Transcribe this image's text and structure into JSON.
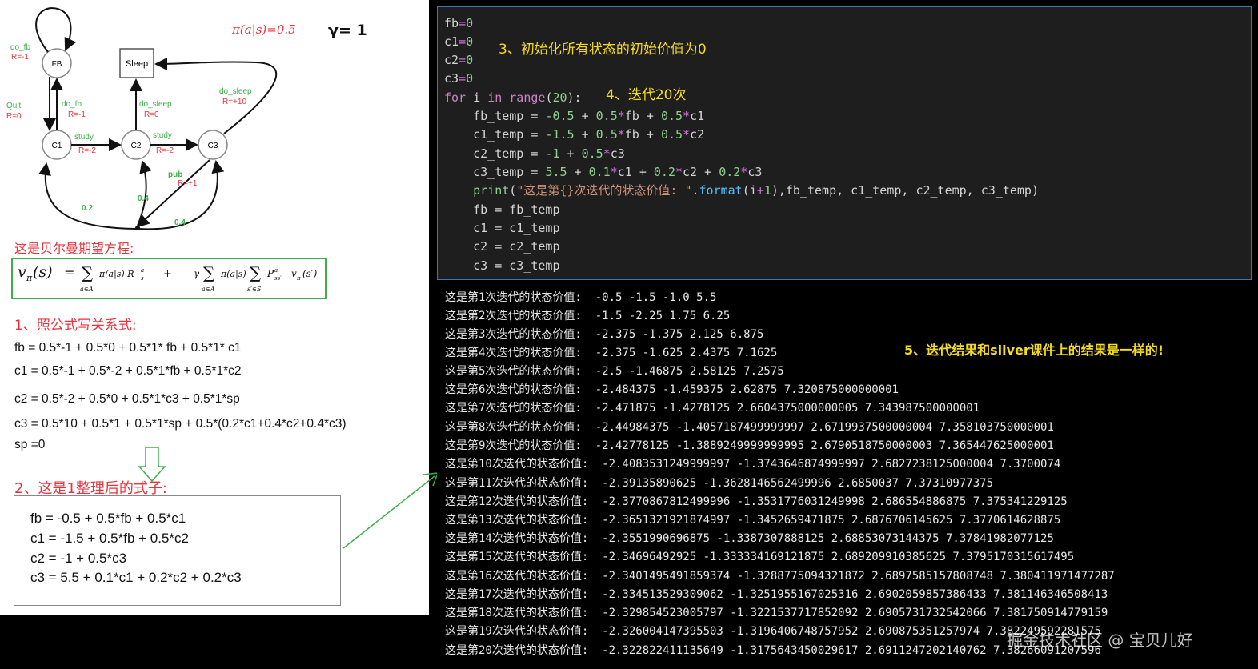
{
  "diagram": {
    "policy": "π(a|s)=0.5",
    "gamma": "γ= 1",
    "states": {
      "fb": "FB",
      "sleep": "Sleep",
      "c1": "C1",
      "c2": "C2",
      "c3": "C3"
    },
    "actions": {
      "do_fb_loop": "do_fb",
      "do_fb_loop_r": "R=-1",
      "quit": "Quit",
      "quit_r": "R=0",
      "do_fb_c1": "do_fb",
      "do_fb_c1_r": "R=-1",
      "do_sleep_c2": "do_sleep",
      "do_sleep_c2_r": "R=0",
      "do_sleep_c3": "do_sleep",
      "do_sleep_c3_r": "R=+10",
      "study1": "study",
      "study1_r": "R=-2",
      "study2": "study",
      "study2_r": "R=-2",
      "pub": "pub",
      "pub_r": "R=+1",
      "p02": "0.2",
      "p04a": "0.4",
      "p04b": "0.4"
    }
  },
  "bellman": {
    "title": "这是贝尔曼期望方程:",
    "lhs": "v",
    "lhs_sub": "π",
    "lhs_arg": "(s)",
    "eq": "=",
    "sum": "∑",
    "under_a": "a∈A",
    "term1": "π(a|s) R",
    "term1_sup": "a",
    "term1_sub": "s",
    "plus": "+",
    "gamma": "γ",
    "term2": "π(a|s)",
    "under_s": "s′∈S",
    "term3": "P",
    "term3_sup": "a",
    "term3_sub": "ss′",
    "term4": "v",
    "term4_sub": "π",
    "term4_arg": "(s′)"
  },
  "step1": {
    "title": "1、照公式写关系式:",
    "lines": [
      "fb = 0.5*-1 + 0.5*0    +   0.5*1* fb + 0.5*1* c1",
      "c1 = 0.5*-1 + 0.5*-2   +   0.5*1*fb + 0.5*1*c2",
      "c2 = 0.5*-2 + 0.5*0    +   0.5*1*c3 + 0.5*1*sp",
      "c3 = 0.5*10 + 0.5*1    +   0.5*1*sp + 0.5*(0.2*c1+0.4*c2+0.4*c3)",
      "sp =0"
    ]
  },
  "step2": {
    "title": "2、这是1整理后的式子:",
    "lines": [
      "fb = -0.5 + 0.5*fb + 0.5*c1",
      "c1 = -1.5 + 0.5*fb + 0.5*c2",
      "c2 = -1 + 0.5*c3",
      "c3 = 5.5 + 0.1*c1 + 0.2*c2 + 0.2*c3"
    ]
  },
  "code": {
    "note3": "3、初始化所有状态的初始价值为0",
    "note4": "4、迭代20次",
    "l1_var": "fb",
    "l1_val": "0",
    "l2_var": "c1",
    "l2_val": "0",
    "l3_var": "c2",
    "l3_val": "0",
    "l4_var": "c3",
    "l4_val": "0",
    "for_kw": "for",
    "for_var": " i ",
    "in_kw": "in",
    "range_fn": "range",
    "range_open": "(",
    "range_n": "20",
    "range_close": "):",
    "fb_temp_a": "    fb_temp = ",
    "fb_temp_b": "-0.5",
    "fb_temp_c": " + ",
    "fb_temp_d": "0.5",
    "fb_temp_e": "*",
    "fb_temp_f": "fb + ",
    "fb_temp_g": "0.5",
    "fb_temp_h": "*",
    "fb_temp_i": "c1",
    "c1_temp_a": "    c1_temp = ",
    "c1_temp_b": "-1.5",
    "c1_temp_c": " + ",
    "c1_temp_d": "0.5",
    "c1_temp_e": "*",
    "c1_temp_f": "fb + ",
    "c1_temp_g": "0.5",
    "c1_temp_h": "*",
    "c1_temp_i": "c2",
    "c2_temp_a": "    c2_temp = ",
    "c2_temp_b": "-1",
    "c2_temp_c": " + ",
    "c2_temp_d": "0.5",
    "c2_temp_e": "*",
    "c2_temp_f": "c3",
    "c3_temp_a": "    c3_temp = ",
    "c3_temp_b": "5.5",
    "c3_temp_c": " + ",
    "c3_temp_d": "0.1",
    "c3_temp_e": "*",
    "c3_temp_f": "c1 + ",
    "c3_temp_g": "0.2",
    "c3_temp_h": "*",
    "c3_temp_i": "c2 + ",
    "c3_temp_j": "0.2",
    "c3_temp_k": "*",
    "c3_temp_l": "c3",
    "print_a": "    ",
    "print_fn": "print",
    "print_b": "(",
    "print_str": "\"这是第{}次迭代的状态价值: \"",
    "print_c": ".",
    "print_fmt": "format",
    "print_d": "(i",
    "print_op": "+",
    "print_one": "1",
    "print_e": "),fb_temp, c1_temp, c2_temp, c3_temp)",
    "asg1": "    fb = fb_temp",
    "asg2": "    c1 = c1_temp",
    "asg3": "    c2 = c2_temp",
    "asg4": "    c3 = c3_temp"
  },
  "output": {
    "note5": "5、迭代结果和silver课件上的结果是一样的!",
    "lines": [
      "这是第1次迭代的状态价值:  -0.5 -1.5 -1.0 5.5",
      "这是第2次迭代的状态价值:  -1.5 -2.25 1.75 6.25",
      "这是第3次迭代的状态价值:  -2.375 -1.375 2.125 6.875",
      "这是第4次迭代的状态价值:  -2.375 -1.625 2.4375 7.1625",
      "这是第5次迭代的状态价值:  -2.5 -1.46875 2.58125 7.2575",
      "这是第6次迭代的状态价值:  -2.484375 -1.459375 2.62875 7.320875000000001",
      "这是第7次迭代的状态价值:  -2.471875 -1.4278125 2.6604375000000005 7.343987500000001",
      "这是第8次迭代的状态价值:  -2.44984375 -1.4057187499999997 2.6719937500000004 7.358103750000001",
      "这是第9次迭代的状态价值:  -2.42778125 -1.3889249999999995 2.6790518750000003 7.365447625000001",
      "这是第10次迭代的状态价值:  -2.4083531249999997 -1.3743646874999997 2.6827238125000004 7.3700074",
      "这是第11次迭代的状态价值:  -2.39135890625 -1.3628146562499996 2.6850037 7.37310977375",
      "这是第12次迭代的状态价值:  -2.3770867812499996 -1.3531776031249998 2.686554886875 7.375341229125",
      "这是第13次迭代的状态价值:  -2.3651321921874997 -1.3452659471875 2.6876706145625 7.3770614628875",
      "这是第14次迭代的状态价值:  -2.3551990696875 -1.3387307888125 2.68853073144375 7.37841982077125",
      "这是第15次迭代的状态价值:  -2.34696492925 -1.333334169121875 2.689209910385625 7.3795170315617495",
      "这是第16次迭代的状态价值:  -2.3401495491859374 -1.3288775094321872 2.6897585157808748 7.380411971477287",
      "这是第17次迭代的状态价值:  -2.334513529309062 -1.3251955167025316 2.6902059857386433 7.381146346508413",
      "这是第18次迭代的状态价值:  -2.329854523005797 -1.3221537717852092 2.6905731732542066 7.381750914779159",
      "这是第19次迭代的状态价值:  -2.326004147395503 -1.3196406748757952 2.690875351257974 7.382249592281575",
      "这是第20次迭代的状态价值:  -2.322822411135649 -1.3175643450029617 2.6911247202140762 7.38266091207596"
    ]
  },
  "watermark": "掘金技术社区 @ 宝贝儿好"
}
